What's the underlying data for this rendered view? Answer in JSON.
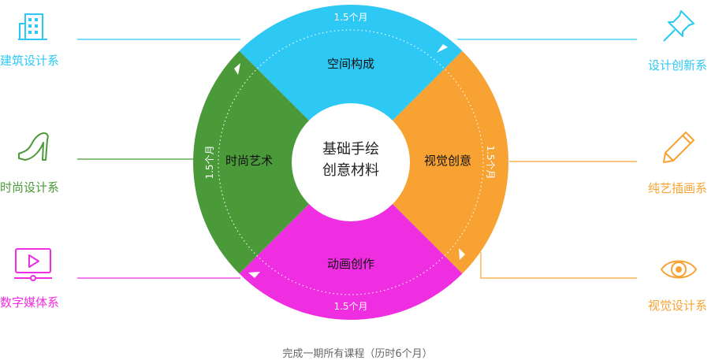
{
  "center": {
    "line1": "基础手绘",
    "line2": "创意材料"
  },
  "segments": {
    "top": {
      "label": "空间构成",
      "color": "#2ec8f5"
    },
    "right": {
      "label": "视觉创意",
      "color": "#f7a232"
    },
    "bottom": {
      "label": "动画创作",
      "color": "#ee2ee0"
    },
    "left": {
      "label": "时尚艺术",
      "color": "#4a9a3a"
    }
  },
  "durations": {
    "top": "1.5个月",
    "right": "1.5个月",
    "bottom": "1.5个月",
    "left": "1.5个月"
  },
  "departments": {
    "architecture": {
      "label": "建筑设计系",
      "icon": "building-icon",
      "color": "#2ec8f5"
    },
    "fashion": {
      "label": "时尚设计系",
      "icon": "high-heel-icon",
      "color": "#4a9a3a"
    },
    "digital": {
      "label": "数字媒体系",
      "icon": "play-screen-icon",
      "color": "#ee2ee0"
    },
    "design": {
      "label": "设计创新系",
      "icon": "pushpin-icon",
      "color": "#2ec8f5"
    },
    "fineart": {
      "label": "纯艺插画系",
      "icon": "pencil-icon",
      "color": "#f7a232"
    },
    "visual": {
      "label": "视觉设计系",
      "icon": "eye-icon",
      "color": "#f7a232"
    }
  },
  "footer": "完成一期所有课程（历时6个月）"
}
